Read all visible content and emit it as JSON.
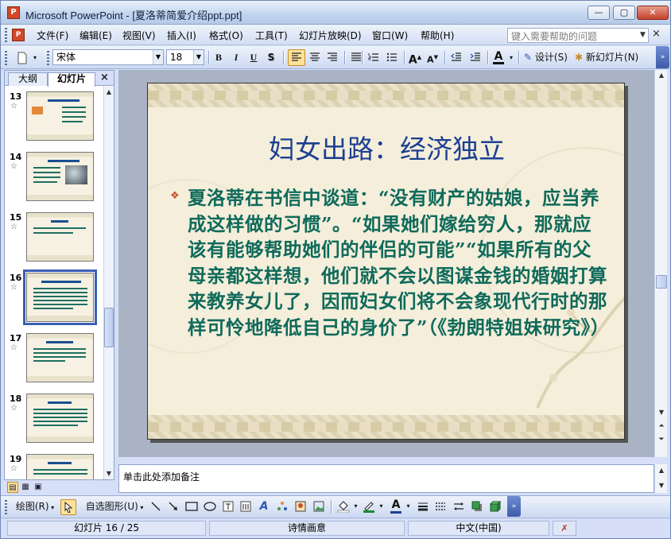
{
  "window": {
    "app_icon": "P",
    "title": "Microsoft PowerPoint - [夏洛蒂简爱介绍ppt.ppt]",
    "minimize_glyph": "—",
    "maximize_glyph": "▢",
    "close_glyph": "✕"
  },
  "menu": {
    "items": [
      "文件(F)",
      "编辑(E)",
      "视图(V)",
      "插入(I)",
      "格式(O)",
      "工具(T)",
      "幻灯片放映(D)",
      "窗口(W)",
      "帮助(H)"
    ],
    "help_placeholder": "键入需要帮助的问题",
    "close_glyph": "×"
  },
  "toolbar": {
    "font_name": "宋体",
    "font_size": "18",
    "bold": "B",
    "italic": "I",
    "underline": "U",
    "shadow": "S",
    "increase_font": "A",
    "decrease_font": "A",
    "design_label": "设计(S)",
    "new_slide_label": "新幻灯片(N)"
  },
  "left_pane": {
    "tab_outline": "大纲",
    "tab_slides": "幻灯片",
    "close_glyph": "×",
    "thumbnails": [
      {
        "number": "13",
        "star": "☆"
      },
      {
        "number": "14",
        "star": "☆"
      },
      {
        "number": "15",
        "star": "☆"
      },
      {
        "number": "16",
        "star": "☆"
      },
      {
        "number": "17",
        "star": "☆"
      },
      {
        "number": "18",
        "star": "☆"
      },
      {
        "number": "19",
        "star": "☆"
      }
    ],
    "selected_index": 3
  },
  "slide": {
    "title": "妇女出路：经济独立",
    "bullet_glyph": "❖",
    "body": "夏洛蒂在书信中谈道：“没有财产的姑娘，应当养成这样做的习惯”。“如果她们嫁给穷人，那就应该有能够帮助她们的伴侣的可能”“如果所有的父母亲都这样想，他们就不会以图谋金钱的婚姻打算来教养女儿了，因而妇女们将不会象现代行时的那样可怜地降低自己的身价了”（《勃朗特姐妹研究》）"
  },
  "notes": {
    "placeholder": "单击此处添加备注"
  },
  "drawing_toolbar": {
    "draw_label": "绘图(R)",
    "autoshapes_label": "自选图形(U)"
  },
  "status": {
    "slide_position": "幻灯片 16 / 25",
    "design_name": "诗情画意",
    "language": "中文(中国)"
  }
}
